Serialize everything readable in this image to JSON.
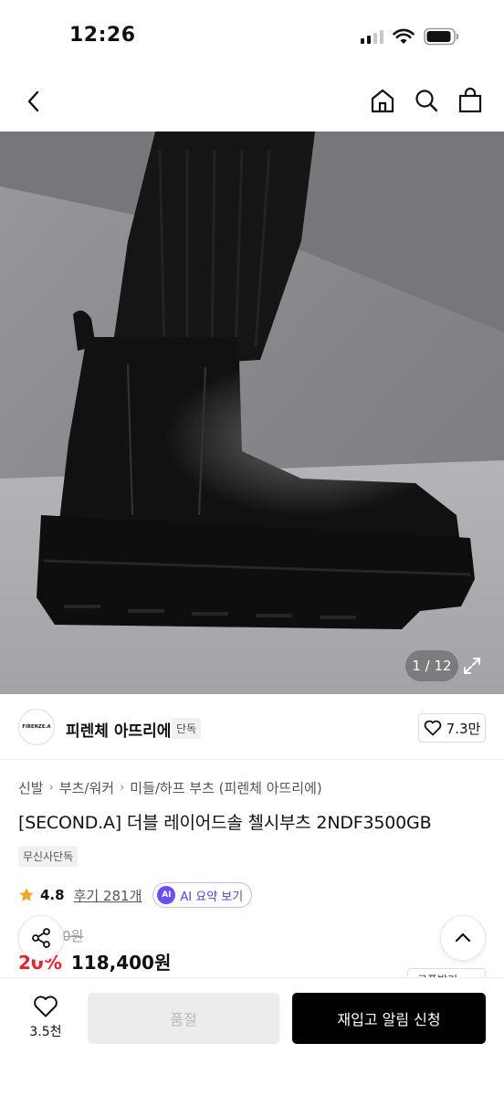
{
  "status": {
    "time": "12:26"
  },
  "gallery": {
    "counter": "1 / 12"
  },
  "brand": {
    "logo_text": "FIRENZE.A",
    "name": "피렌체 아뜨리에",
    "badge": "단독",
    "likes": "7.3만"
  },
  "breadcrumb": [
    "신발",
    "부츠/워커",
    "미들/하프 부츠 (피렌체 아뜨리에)"
  ],
  "product": {
    "title": "[SECOND.A] 더블 레이어드솔 첼시부츠 2NDF3500GB",
    "badge": "무신사단독",
    "rating": "4.8",
    "reviews": "후기 281개",
    "ai_badge": "AI",
    "ai_summary": "AI 요약 보기",
    "original_price": "0원",
    "discount": "20%",
    "price": "118,400원",
    "coupon": "쿠폰받기"
  },
  "bottom": {
    "wish_count": "3.5천",
    "soldout_label": "품절",
    "restock_label": "재입고 알림 신청"
  },
  "colors": {
    "accent": "#e8262f",
    "ai": "#6b4ef0",
    "star": "#f5a623"
  }
}
